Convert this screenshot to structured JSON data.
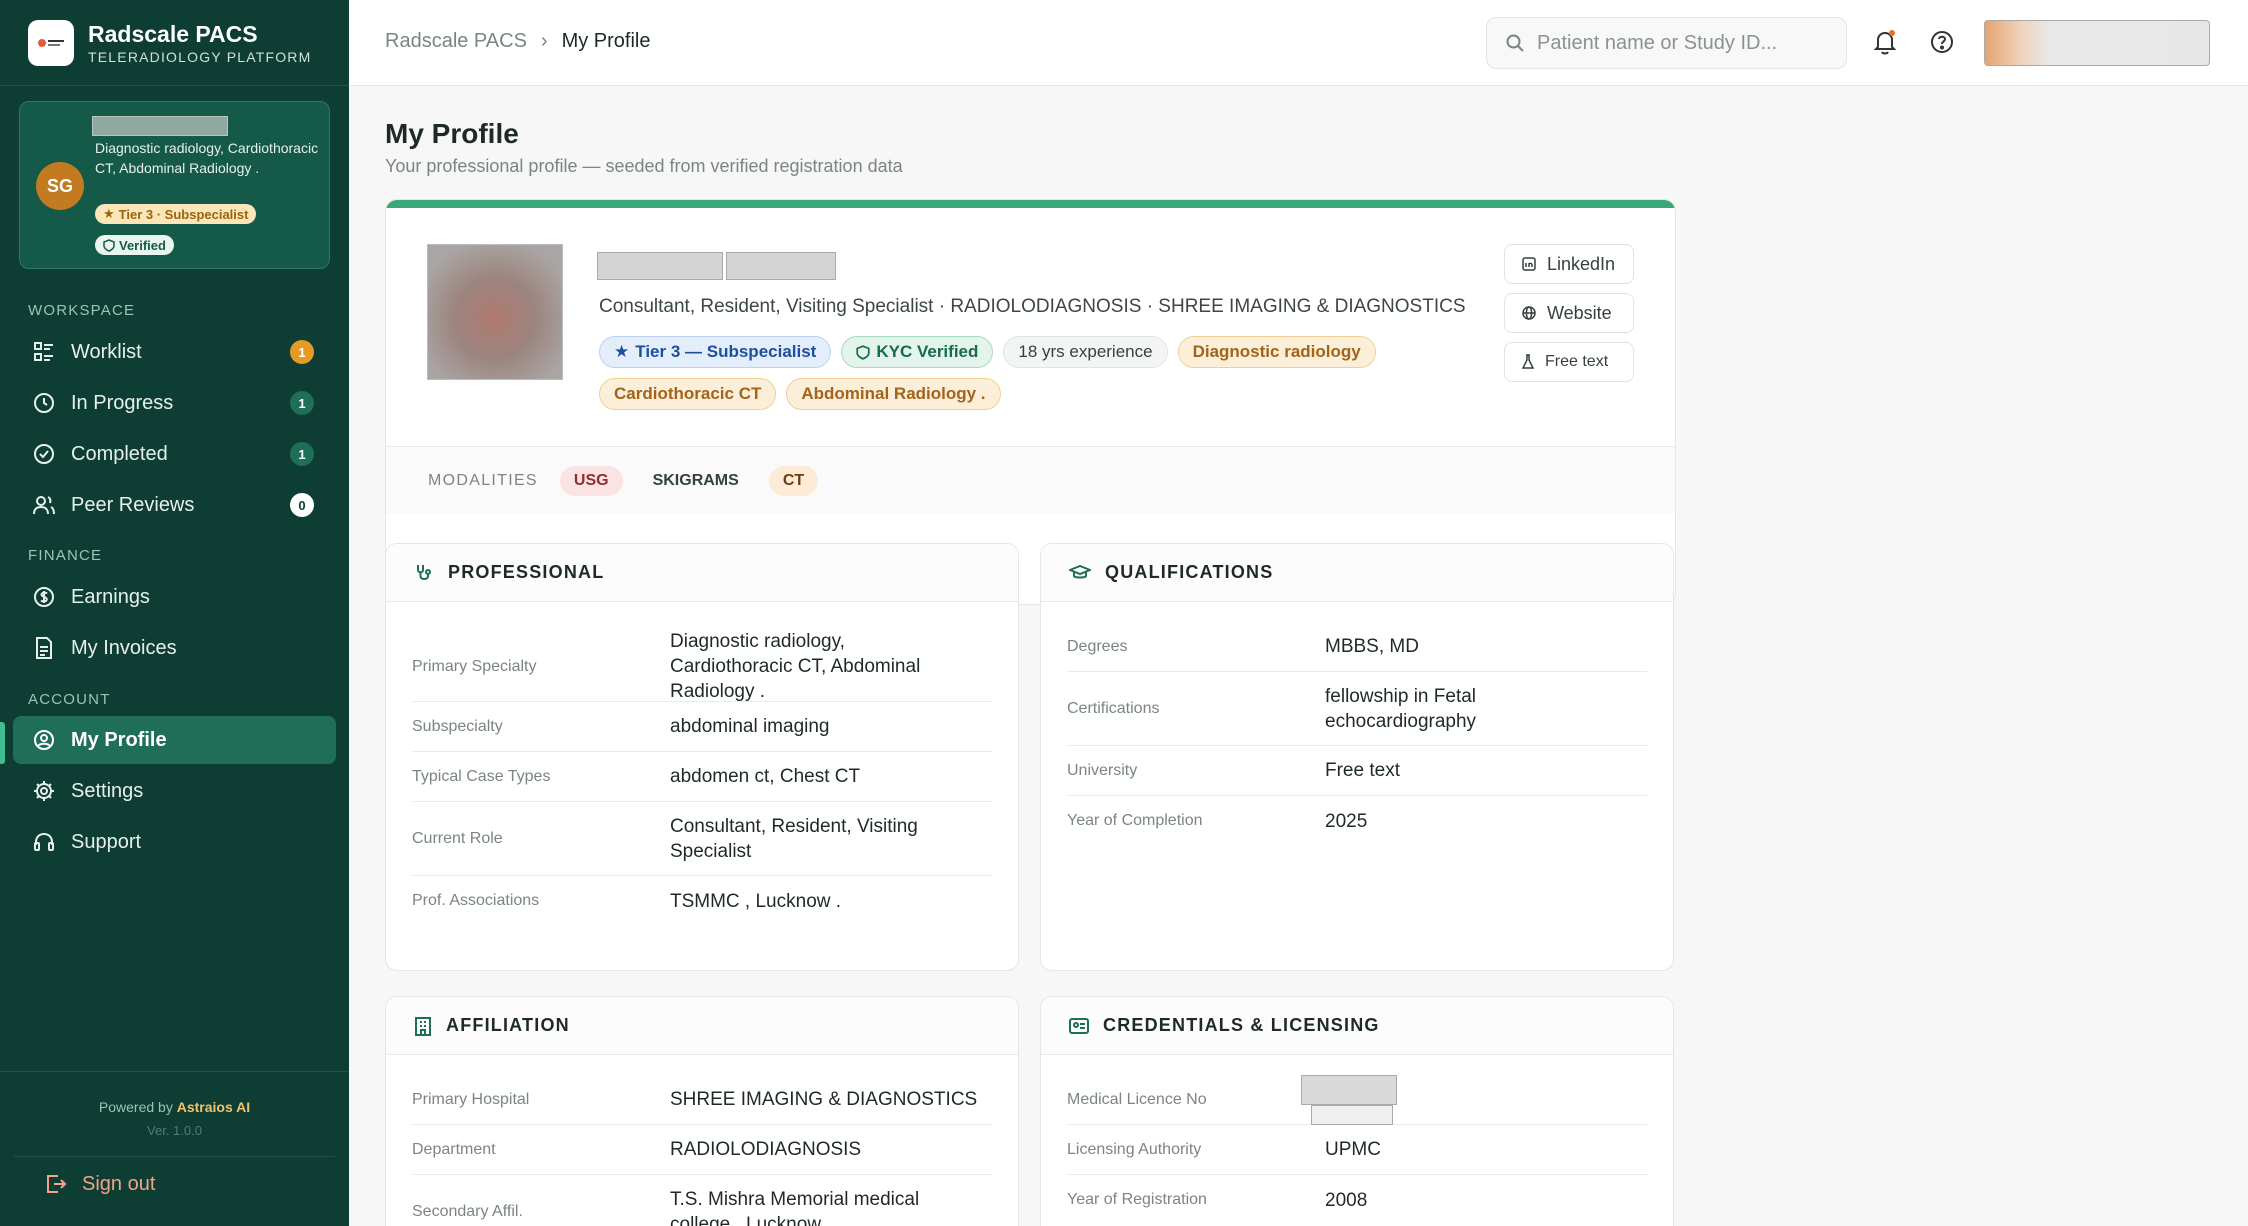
{
  "brand": {
    "name": "Radscale PACS",
    "subtitle": "TELERADIOLOGY PLATFORM"
  },
  "user_card": {
    "initials": "SG",
    "specialty": "Diagnostic radiology, Cardiothoracic CT, Abdominal Radiology .",
    "tier": "Tier 3 · Subspecialist",
    "verified": "Verified"
  },
  "sidebar": {
    "workspace_label": "WORKSPACE",
    "finance_label": "FINANCE",
    "account_label": "ACCOUNT",
    "items": [
      {
        "label": "Worklist",
        "badge": "1",
        "icon": "worklist-icon"
      },
      {
        "label": "In Progress",
        "badge": "1",
        "icon": "clock-icon"
      },
      {
        "label": "Completed",
        "badge": "1",
        "icon": "check-circle-icon"
      },
      {
        "label": "Peer Reviews",
        "badge": "0",
        "icon": "users-icon"
      },
      {
        "label": "Earnings",
        "icon": "dollar-icon"
      },
      {
        "label": "My Invoices",
        "icon": "invoice-icon"
      },
      {
        "label": "My Profile",
        "icon": "user-circle-icon",
        "active": true
      },
      {
        "label": "Settings",
        "icon": "gear-icon"
      },
      {
        "label": "Support",
        "icon": "headset-icon"
      }
    ],
    "powered_prefix": "Powered by",
    "powered_by": "Astraios AI",
    "version": "Ver. 1.0.0",
    "signout": "Sign out"
  },
  "topbar": {
    "breadcrumb": [
      "Radscale PACS",
      "My Profile"
    ],
    "search_placeholder": "Patient name or Study ID..."
  },
  "page": {
    "title": "My Profile",
    "subtitle": "Your professional profile — seeded from verified registration data"
  },
  "hero": {
    "roles": "Consultant, Resident, Visiting Specialist · RADIOLODIAGNOSIS · SHREE IMAGING & DIAGNOSTICS",
    "chips": [
      {
        "label": "Tier 3 — Subspecialist",
        "style": "blue",
        "icon": "star-icon"
      },
      {
        "label": "KYC Verified",
        "style": "green",
        "icon": "shield-icon"
      },
      {
        "label": "18 yrs experience",
        "style": "grey"
      },
      {
        "label": "Diagnostic radiology",
        "style": "amber"
      },
      {
        "label": "Cardiothoracic CT",
        "style": "amber"
      },
      {
        "label": "Abdominal Radiology .",
        "style": "amber"
      }
    ],
    "links": {
      "linkedin": "LinkedIn",
      "website": "Website",
      "free_text": "Free text"
    },
    "modalities_label": "MODALITIES",
    "modalities": [
      "USG",
      "SKIGRAMS",
      "CT"
    ]
  },
  "professional": {
    "title": "PROFESSIONAL",
    "rows": [
      {
        "label": "Primary Specialty",
        "value": "Diagnostic radiology, Cardiothoracic CT, Abdominal Radiology ."
      },
      {
        "label": "Subspecialty",
        "value": "abdominal imaging"
      },
      {
        "label": "Typical Case Types",
        "value": "abdomen ct, Chest CT"
      },
      {
        "label": "Current Role",
        "value": "Consultant, Resident, Visiting Specialist"
      },
      {
        "label": "Prof. Associations",
        "value": "TSMMC , Lucknow ."
      }
    ]
  },
  "qualifications": {
    "title": "QUALIFICATIONS",
    "rows": [
      {
        "label": "Degrees",
        "value": "MBBS, MD"
      },
      {
        "label": "Certifications",
        "value": "fellowship in Fetal echocardiography"
      },
      {
        "label": "University",
        "value": "Free text"
      },
      {
        "label": "Year of Completion",
        "value": "2025"
      }
    ]
  },
  "affiliation": {
    "title": "AFFILIATION",
    "rows": [
      {
        "label": "Primary Hospital",
        "value": "SHREE IMAGING & DIAGNOSTICS"
      },
      {
        "label": "Department",
        "value": "RADIOLODIAGNOSIS"
      },
      {
        "label": "Secondary Affil.",
        "value": "T.S. Mishra Memorial medical college , Lucknow ."
      }
    ]
  },
  "credentials": {
    "title": "CREDENTIALS & LICENSING",
    "rows": [
      {
        "label": "Medical Licence No",
        "value": ""
      },
      {
        "label": "Licensing Authority",
        "value": "UPMC"
      },
      {
        "label": "Year of Registration",
        "value": "2008"
      }
    ]
  }
}
